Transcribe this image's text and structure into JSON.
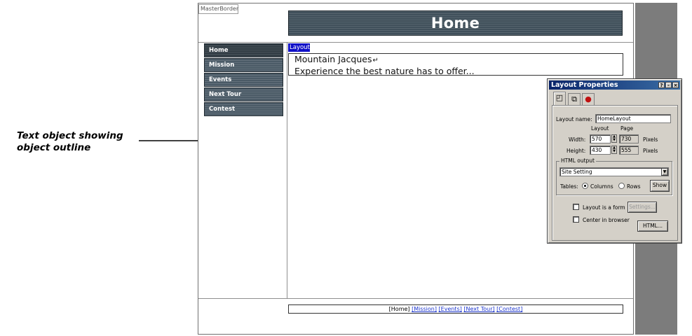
{
  "callout": {
    "line1": "Text object showing",
    "line2": "object outline"
  },
  "canvas": {
    "master_tag": "MasterBorder",
    "header_title": "Home",
    "nav_items": [
      "Home",
      "Mission",
      "Events",
      "Next Tour",
      "Contest"
    ],
    "layout_tag": "Layout",
    "text_line1": "Mountain Jacques",
    "text_line2": "Experience the best nature has to offer...",
    "footer": {
      "home": "[Home]",
      "links": [
        "[Mission]",
        "[Events]",
        "[Next Tour]",
        "[Contest]"
      ]
    }
  },
  "palette": {
    "title": "Layout Properties",
    "title_buttons": [
      "?",
      "-",
      "×"
    ],
    "layout_name_label": "Layout name:",
    "layout_name_value": "HomeLayout",
    "col_layout": "Layout",
    "col_page": "Page",
    "width_label": "Width:",
    "width_value": "570",
    "width_page": "730",
    "height_label": "Height:",
    "height_value": "430",
    "height_page": "555",
    "pixels": "Pixels",
    "html_output_label": "HTML output",
    "select_value": "Site Setting",
    "tables_label": "Tables:",
    "columns_label": "Columns",
    "rows_label": "Rows",
    "show_button": "Show",
    "form_checkbox_label": "Layout is a form",
    "settings_button": "Settings...",
    "center_checkbox_label": "Center in browser",
    "html_button": "HTML..."
  }
}
